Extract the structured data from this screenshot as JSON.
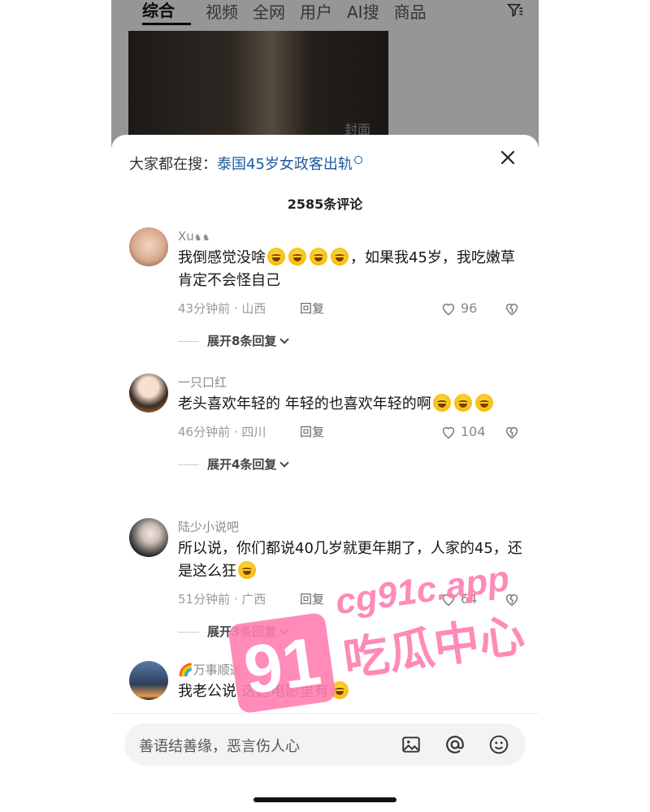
{
  "tabs": [
    "综合",
    "视频",
    "全网",
    "用户",
    "AI搜",
    "商品"
  ],
  "active_tab": 0,
  "video_label": "封面",
  "hot_search": {
    "prefix": "大家都在搜：",
    "keyword": "泰国45岁女政客出轨"
  },
  "comment_count_text": "2585条评论",
  "comments": [
    {
      "name": "Xu",
      "name_suffix": "♞♞",
      "text_a": "我倒感觉没啥",
      "emojis_a": 4,
      "text_b": "，如果我45岁，我吃嫩草肯定不会怪自己",
      "emojis_b": 0,
      "meta": "43分钟前 · 山西",
      "reply_label": "回复",
      "likes": "96",
      "expand": "展开8条回复",
      "avatar_color": "#d9b89a"
    },
    {
      "name": "一只口红",
      "name_suffix": "",
      "text_a": "老头喜欢年轻的 年轻的也喜欢年轻的啊",
      "emojis_a": 3,
      "text_b": "",
      "emojis_b": 0,
      "meta": "46分钟前 · 四川",
      "reply_label": "回复",
      "likes": "104",
      "expand": "展开4条回复",
      "avatar_color": "#3a2a22"
    },
    {
      "name": "陆少小说吧",
      "name_suffix": "",
      "text_a": "所以说，你们都说40几岁就更年期了，人家的45，还是这么狂",
      "emojis_a": 1,
      "text_b": "",
      "emojis_b": 0,
      "meta": "51分钟前 · 广西",
      "reply_label": "回复",
      "likes": "64",
      "expand": "展开3条回复",
      "avatar_color": "#2b2b2b"
    },
    {
      "name": "🌈万事顺遂",
      "name_suffix": "",
      "text_a": "我老公说 这题电影里有",
      "emojis_a": 1,
      "text_b": "",
      "emojis_b": 0,
      "meta": "",
      "reply_label": "",
      "likes": "",
      "expand": "",
      "avatar_color": "#2c3e5c"
    }
  ],
  "input_placeholder": "善语结善缘，恶言伤人心",
  "watermark": {
    "number": "91",
    "site": "cg91c.app",
    "slogan": "吃瓜中心",
    "color": "#ff7eb0"
  },
  "icons": {
    "filter": "filter-icon",
    "close": "close-icon",
    "like": "heart-icon",
    "dislike": "broken-heart-icon",
    "image": "image-icon",
    "mention": "at-icon",
    "emoji": "smiley-icon"
  }
}
